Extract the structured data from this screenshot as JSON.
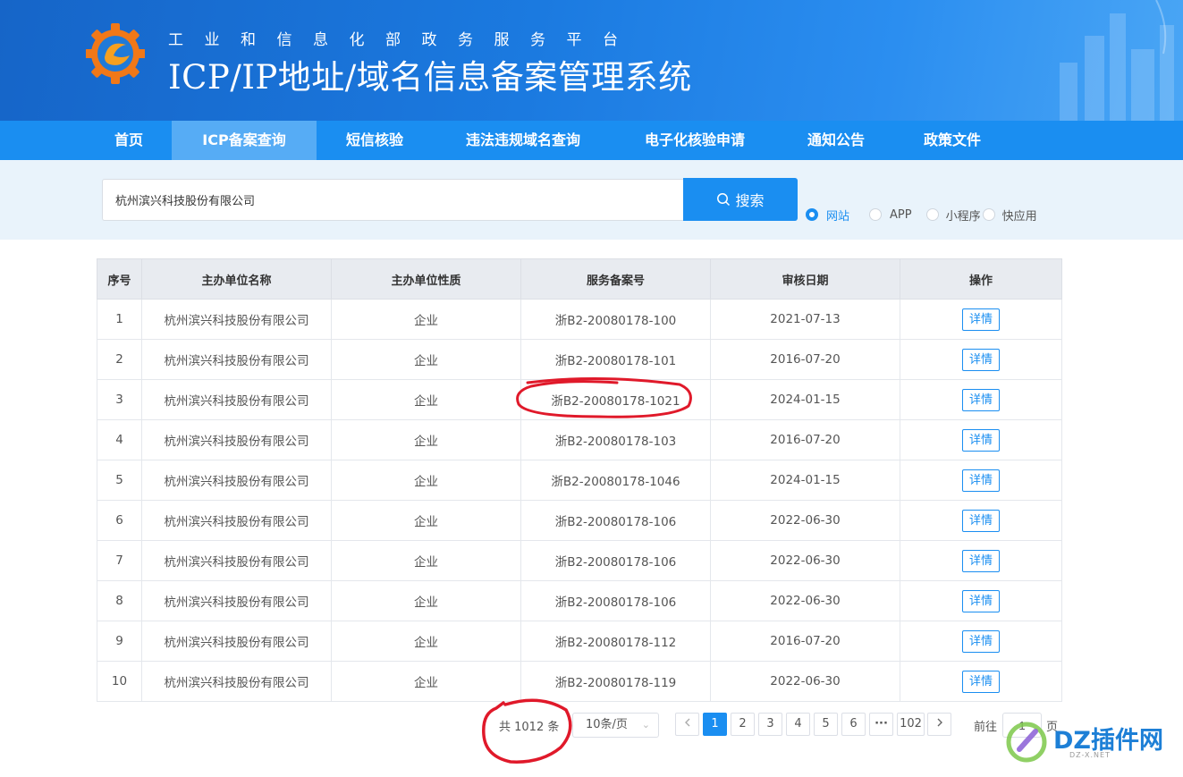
{
  "header": {
    "subtitle": "工业和信息化部政务服务平台",
    "title": "ICP/IP地址/域名信息备案管理系统"
  },
  "nav": {
    "items": [
      {
        "label": "首页",
        "active": false
      },
      {
        "label": "ICP备案查询",
        "active": true
      },
      {
        "label": "短信核验",
        "active": false
      },
      {
        "label": "违法违规域名查询",
        "active": false
      },
      {
        "label": "电子化核验申请",
        "active": false
      },
      {
        "label": "通知公告",
        "active": false
      },
      {
        "label": "政策文件",
        "active": false
      }
    ]
  },
  "search": {
    "value": "杭州滨兴科技股份有限公司",
    "button_label": "搜索",
    "types": [
      {
        "label": "网站",
        "checked": true
      },
      {
        "label": "APP",
        "checked": false
      },
      {
        "label": "小程序",
        "checked": false
      },
      {
        "label": "快应用",
        "checked": false
      }
    ]
  },
  "table": {
    "columns": [
      "序号",
      "主办单位名称",
      "主办单位性质",
      "服务备案号",
      "审核日期",
      "操作"
    ],
    "action_label": "详情",
    "rows": [
      {
        "no": "1",
        "name": "杭州滨兴科技股份有限公司",
        "nature": "企业",
        "license": "浙B2-20080178-100",
        "date": "2021-07-13"
      },
      {
        "no": "2",
        "name": "杭州滨兴科技股份有限公司",
        "nature": "企业",
        "license": "浙B2-20080178-101",
        "date": "2016-07-20"
      },
      {
        "no": "3",
        "name": "杭州滨兴科技股份有限公司",
        "nature": "企业",
        "license": "浙B2-20080178-1021",
        "date": "2024-01-15"
      },
      {
        "no": "4",
        "name": "杭州滨兴科技股份有限公司",
        "nature": "企业",
        "license": "浙B2-20080178-103",
        "date": "2016-07-20"
      },
      {
        "no": "5",
        "name": "杭州滨兴科技股份有限公司",
        "nature": "企业",
        "license": "浙B2-20080178-1046",
        "date": "2024-01-15"
      },
      {
        "no": "6",
        "name": "杭州滨兴科技股份有限公司",
        "nature": "企业",
        "license": "浙B2-20080178-106",
        "date": "2022-06-30"
      },
      {
        "no": "7",
        "name": "杭州滨兴科技股份有限公司",
        "nature": "企业",
        "license": "浙B2-20080178-106",
        "date": "2022-06-30"
      },
      {
        "no": "8",
        "name": "杭州滨兴科技股份有限公司",
        "nature": "企业",
        "license": "浙B2-20080178-106",
        "date": "2022-06-30"
      },
      {
        "no": "9",
        "name": "杭州滨兴科技股份有限公司",
        "nature": "企业",
        "license": "浙B2-20080178-112",
        "date": "2016-07-20"
      },
      {
        "no": "10",
        "name": "杭州滨兴科技股份有限公司",
        "nature": "企业",
        "license": "浙B2-20080178-119",
        "date": "2022-06-30"
      }
    ]
  },
  "pagination": {
    "total_text": "共 1012 条",
    "page_size": "10条/页",
    "prev_icon": "chevron-left-icon",
    "next_icon": "chevron-right-icon",
    "pages": [
      "1",
      "2",
      "3",
      "4",
      "5",
      "6"
    ],
    "current_page": "1",
    "ellipsis": "···",
    "last_page": "102",
    "goto_label": "前往",
    "goto_value": "1",
    "goto_unit": "页"
  },
  "watermark": {
    "text": "DZ插件网",
    "url": "DZ-X.NET"
  },
  "colors": {
    "primary": "#1a8ef1",
    "nav_active": "#56acf5",
    "annotation": "#e0192a"
  }
}
